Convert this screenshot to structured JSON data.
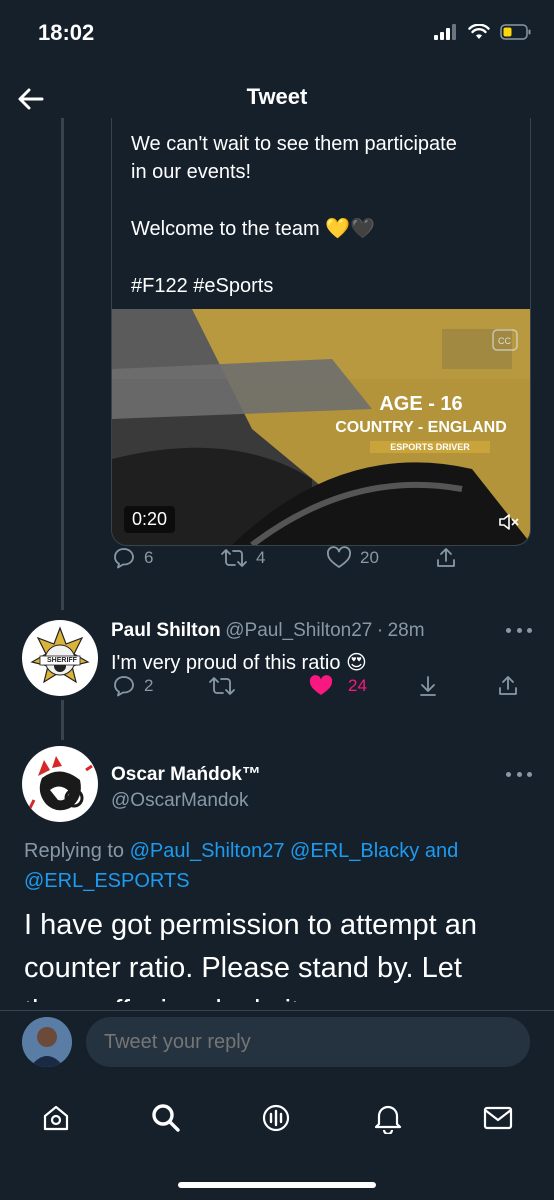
{
  "status": {
    "time": "18:02"
  },
  "header": {
    "title": "Tweet"
  },
  "quoted_tweet": {
    "line1": "We can't wait to see them participate",
    "line2": "in our events!",
    "line3": "Welcome to the team 💛🖤",
    "line4": "#F122 #eSports",
    "video": {
      "overlay_age": "AGE - 16",
      "overlay_country": "COUNTRY - ENGLAND",
      "overlay_sub": "ESPORTS DRIVER",
      "duration": "0:20"
    },
    "actions": {
      "replies": "6",
      "retweets": "4",
      "likes": "20"
    }
  },
  "reply1": {
    "name": "Paul Shilton",
    "handle": "@Paul_Shilton27",
    "dot": "·",
    "time": "28m",
    "text": "I'm very proud of this ratio 😍",
    "avatar_text": "SHERIFF",
    "actions": {
      "replies": "2",
      "likes": "24"
    },
    "like_color": "#f91880"
  },
  "reply2": {
    "name": "Oscar Mańdok™",
    "handle": "@OscarMandok",
    "replying_prefix": "Replying to",
    "mention1": "@Paul_Shilton27",
    "mention2": "@ERL_Blacky",
    "and": "and",
    "mention3": "@ERL_ESPORTS",
    "text1": "I have got permission to attempt an",
    "text2": "counter ratio. Please stand by. Let",
    "text3": "the proffesionals do it"
  },
  "reply_box": {
    "placeholder": "Tweet your reply"
  },
  "tabs": [
    "home-icon",
    "search-icon",
    "spaces-icon",
    "notifications-icon",
    "messages-icon"
  ],
  "colors": {
    "background": "#15202b",
    "accent": "#1d9bf0",
    "muted": "#8899a6",
    "like": "#f91880",
    "video_yellow": "#c9a43b"
  }
}
